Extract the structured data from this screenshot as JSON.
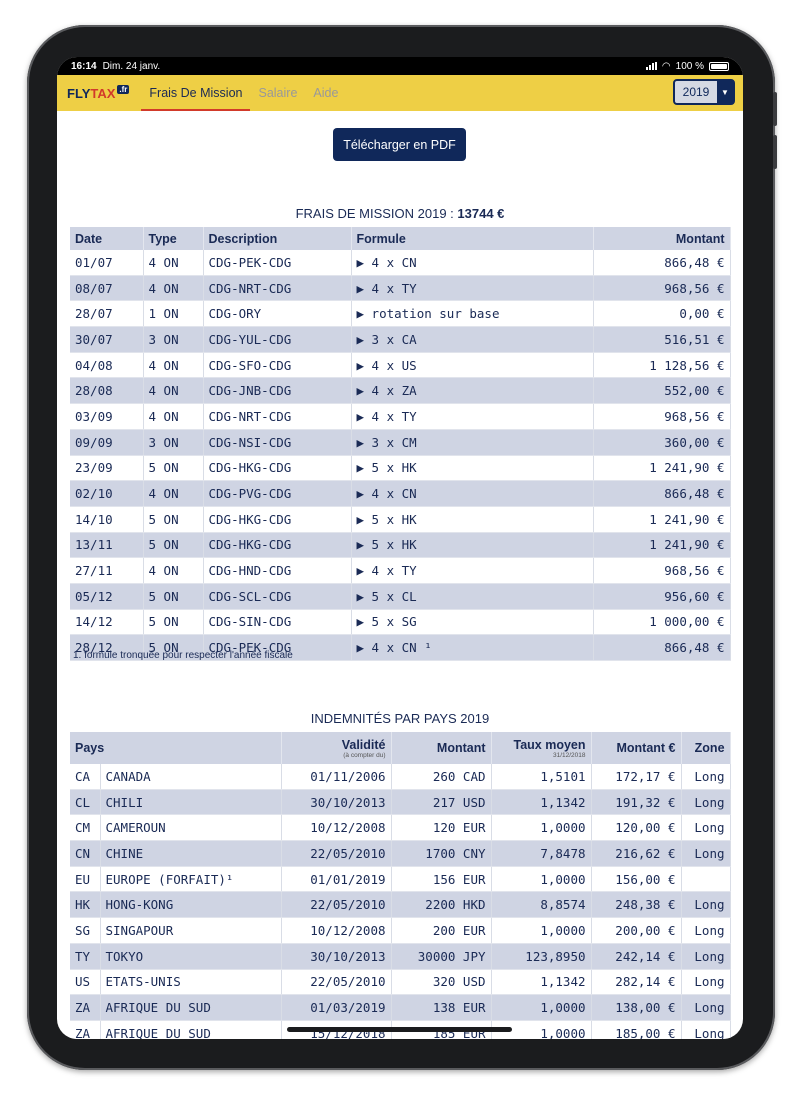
{
  "status": {
    "time": "16:14",
    "date": "Dim. 24 janv.",
    "battery": "100 %"
  },
  "nav": {
    "logo_fly": "FLY",
    "logo_tax": "TAX",
    "logo_fr": ".fr",
    "tabs": [
      {
        "label": "Frais De Mission",
        "active": true
      },
      {
        "label": "Salaire",
        "active": false
      },
      {
        "label": "Aide",
        "active": false
      }
    ],
    "year": "2019"
  },
  "pdf_button": "Télécharger en PDF",
  "missions": {
    "title_prefix": "FRAIS DE MISSION 2019 :",
    "total": "13744 €",
    "headers": {
      "date": "Date",
      "type": "Type",
      "description": "Description",
      "formule": "Formule",
      "montant": "Montant"
    },
    "rows": [
      {
        "date": "01/07",
        "type": "4 ON",
        "description": "CDG-PEK-CDG",
        "formule": "▶ 4 x CN",
        "montant": "866,48 €"
      },
      {
        "date": "08/07",
        "type": "4 ON",
        "description": "CDG-NRT-CDG",
        "formule": "▶ 4 x TY",
        "montant": "968,56 €"
      },
      {
        "date": "28/07",
        "type": "1 ON",
        "description": "CDG-ORY",
        "formule": "▶ rotation sur base",
        "montant": "0,00 €"
      },
      {
        "date": "30/07",
        "type": "3 ON",
        "description": "CDG-YUL-CDG",
        "formule": "▶ 3 x CA",
        "montant": "516,51 €"
      },
      {
        "date": "04/08",
        "type": "4 ON",
        "description": "CDG-SFO-CDG",
        "formule": "▶ 4 x US",
        "montant": "1 128,56 €"
      },
      {
        "date": "28/08",
        "type": "4 ON",
        "description": "CDG-JNB-CDG",
        "formule": "▶ 4 x ZA",
        "montant": "552,00 €"
      },
      {
        "date": "03/09",
        "type": "4 ON",
        "description": "CDG-NRT-CDG",
        "formule": "▶ 4 x TY",
        "montant": "968,56 €"
      },
      {
        "date": "09/09",
        "type": "3 ON",
        "description": "CDG-NSI-CDG",
        "formule": "▶ 3 x CM",
        "montant": "360,00 €"
      },
      {
        "date": "23/09",
        "type": "5 ON",
        "description": "CDG-HKG-CDG",
        "formule": "▶ 5 x HK",
        "montant": "1 241,90 €"
      },
      {
        "date": "02/10",
        "type": "4 ON",
        "description": "CDG-PVG-CDG",
        "formule": "▶ 4 x CN",
        "montant": "866,48 €"
      },
      {
        "date": "14/10",
        "type": "5 ON",
        "description": "CDG-HKG-CDG",
        "formule": "▶ 5 x HK",
        "montant": "1 241,90 €"
      },
      {
        "date": "13/11",
        "type": "5 ON",
        "description": "CDG-HKG-CDG",
        "formule": "▶ 5 x HK",
        "montant": "1 241,90 €"
      },
      {
        "date": "27/11",
        "type": "4 ON",
        "description": "CDG-HND-CDG",
        "formule": "▶ 4 x TY",
        "montant": "968,56 €"
      },
      {
        "date": "05/12",
        "type": "5 ON",
        "description": "CDG-SCL-CDG",
        "formule": "▶ 5 x CL",
        "montant": "956,60 €"
      },
      {
        "date": "14/12",
        "type": "5 ON",
        "description": "CDG-SIN-CDG",
        "formule": "▶ 5 x SG",
        "montant": "1 000,00 €"
      },
      {
        "date": "28/12",
        "type": "5 ON",
        "description": "CDG-PEK-CDG",
        "formule": "▶ 4 x CN ¹",
        "montant": "866,48 €"
      }
    ],
    "footnote": "1. formule tronquée pour respecter l'année fiscale"
  },
  "indemnites": {
    "title": "INDEMNITÉS PAR PAYS 2019",
    "headers": {
      "pays": "Pays",
      "validite": "Validité",
      "validite_sub": "(à compter du)",
      "montant": "Montant",
      "taux": "Taux moyen",
      "taux_sub": "31/12/2018",
      "montant_eur": "Montant €",
      "zone": "Zone"
    },
    "rows": [
      {
        "code": "CA",
        "pays": "CANADA",
        "validite": "01/11/2006",
        "montant": "260 CAD",
        "taux": "1,5101",
        "montant_eur": "172,17 €",
        "zone": "Long"
      },
      {
        "code": "CL",
        "pays": "CHILI",
        "validite": "30/10/2013",
        "montant": "217 USD",
        "taux": "1,1342",
        "montant_eur": "191,32 €",
        "zone": "Long"
      },
      {
        "code": "CM",
        "pays": "CAMEROUN",
        "validite": "10/12/2008",
        "montant": "120 EUR",
        "taux": "1,0000",
        "montant_eur": "120,00 €",
        "zone": "Long"
      },
      {
        "code": "CN",
        "pays": "CHINE",
        "validite": "22/05/2010",
        "montant": "1700 CNY",
        "taux": "7,8478",
        "montant_eur": "216,62 €",
        "zone": "Long"
      },
      {
        "code": "EU",
        "pays": "EUROPE (FORFAIT)¹",
        "validite": "01/01/2019",
        "montant": "156 EUR",
        "taux": "1,0000",
        "montant_eur": "156,00 €",
        "zone": ""
      },
      {
        "code": "HK",
        "pays": "HONG-KONG",
        "validite": "22/05/2010",
        "montant": "2200 HKD",
        "taux": "8,8574",
        "montant_eur": "248,38 €",
        "zone": "Long"
      },
      {
        "code": "SG",
        "pays": "SINGAPOUR",
        "validite": "10/12/2008",
        "montant": "200 EUR",
        "taux": "1,0000",
        "montant_eur": "200,00 €",
        "zone": "Long"
      },
      {
        "code": "TY",
        "pays": "TOKYO",
        "validite": "30/10/2013",
        "montant": "30000 JPY",
        "taux": "123,8950",
        "montant_eur": "242,14 €",
        "zone": "Long"
      },
      {
        "code": "US",
        "pays": "ETATS-UNIS",
        "validite": "22/05/2010",
        "montant": "320 USD",
        "taux": "1,1342",
        "montant_eur": "282,14 €",
        "zone": "Long"
      },
      {
        "code": "ZA",
        "pays": "AFRIQUE DU SUD",
        "validite": "01/03/2019",
        "montant": "138 EUR",
        "taux": "1,0000",
        "montant_eur": "138,00 €",
        "zone": "Long"
      },
      {
        "code": "ZA",
        "pays": "AFRIQUE DU SUD",
        "validite": "15/12/2018",
        "montant": "185 EUR",
        "taux": "1,0000",
        "montant_eur": "185,00 €",
        "zone": "Long"
      }
    ]
  }
}
